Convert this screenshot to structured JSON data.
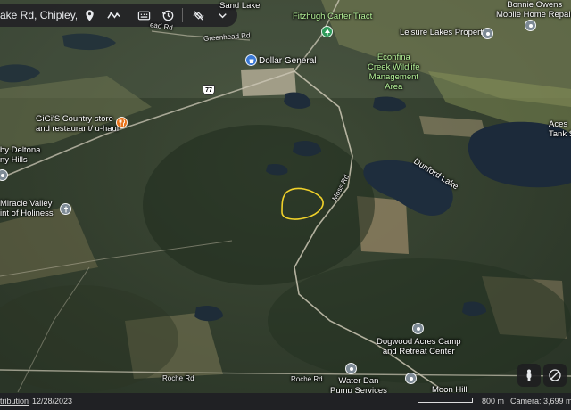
{
  "search": {
    "value": "ake Rd, Chipley, FL"
  },
  "toolbar_icons": [
    "location-pin-icon",
    "route-icon",
    "keyboard-icon",
    "history-icon",
    "satellite-off-icon",
    "chevron-down-icon"
  ],
  "labels": {
    "sand_lake": "Sand Lake",
    "fitzhugh": "Fitzhugh Carter Tract",
    "bonnie_line1": "Bonnie Owens",
    "bonnie_line2": "Mobile Home Repair",
    "leisure": "Leisure Lakes Property",
    "greenhead": "Greenhead Rd",
    "dollar_general": "Dollar General",
    "shield": "77",
    "econfina_line1": "Econfina",
    "econfina_line2": "Creek Wildlife",
    "econfina_line3": "Management",
    "econfina_line4": "Area",
    "gigis_line1": "GiGi'S Country store",
    "gigis_line2": "and restaurant/ u-haul",
    "acres_line1": "Aces",
    "acres_line2": "Tank S",
    "deltona_line1": "by Deltona",
    "deltona_line2": "ny Hills",
    "dunford": "Dunford Lake",
    "miracle_line1": "Miracle Valley",
    "miracle_line2": "int of Holiness",
    "dogwood_line1": "Dogwood Acres Camp",
    "dogwood_line2": "and Retreat Center",
    "roche_left": "Roche Rd",
    "roche_right": "Roche Rd",
    "water_line1": "Water Dan",
    "water_line2": "Pump Services",
    "moon_hill": "Moon Hill",
    "map_road": "Moss Rd"
  },
  "status": {
    "attribution": "tribution",
    "date": "12/28/2023",
    "scale": "800 m",
    "camera": "Camera: 3,699 m"
  },
  "colors": {
    "toolbar_bg": "#232326",
    "pin_grey": "#7d8a95",
    "pin_blue": "#3a79d6",
    "pin_green": "#2f9a5a",
    "pin_orange": "#e8731b",
    "parcel_outline": "#f0d12a",
    "statusbar_bg": "#202124"
  }
}
